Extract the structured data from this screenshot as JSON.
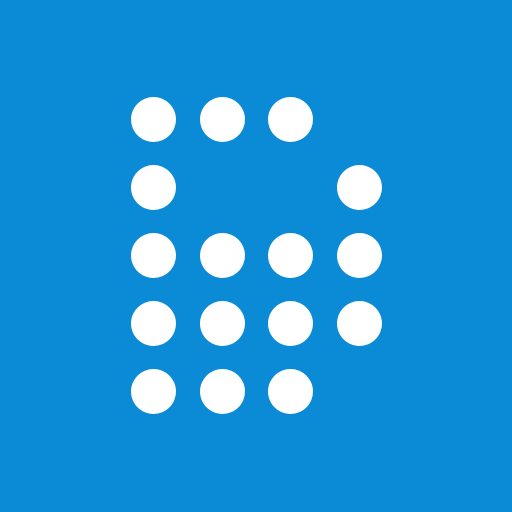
{
  "logo": {
    "icon_name": "dot-matrix-b-logo",
    "background_color": "#0b8ad6",
    "dot_color": "#ffffff",
    "grid_rows": 5,
    "grid_cols": 4,
    "dot_pattern": [
      [
        1,
        1,
        1,
        0
      ],
      [
        1,
        0,
        0,
        1
      ],
      [
        1,
        1,
        1,
        1
      ],
      [
        1,
        1,
        1,
        1
      ],
      [
        1,
        1,
        1,
        0
      ]
    ]
  }
}
